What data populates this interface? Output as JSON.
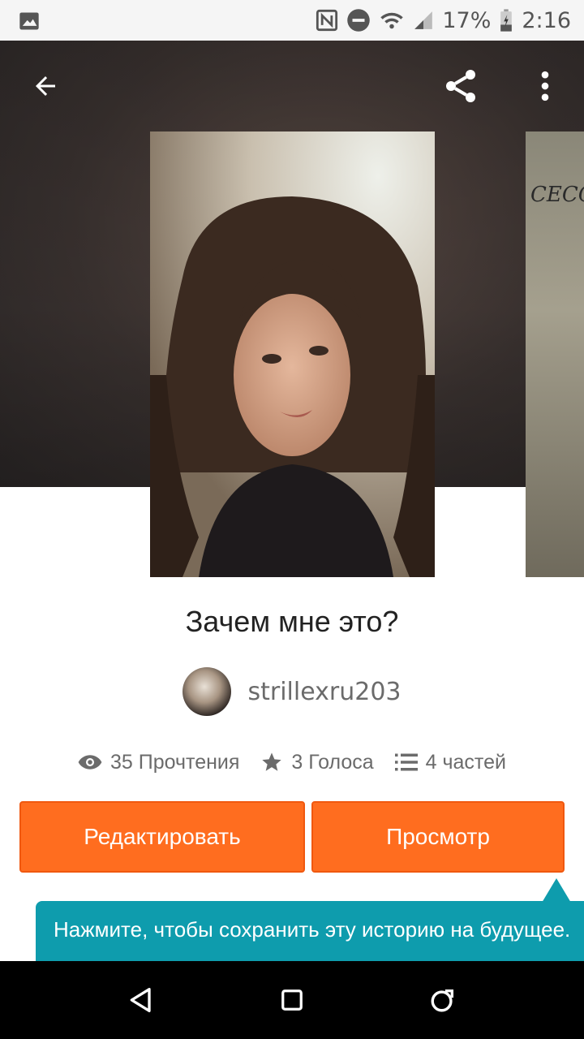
{
  "status_bar": {
    "battery": "17%",
    "time": "2:16",
    "icons": [
      "image-icon",
      "nfc-icon",
      "dnd-icon",
      "wifi-icon",
      "signal-icon",
      "battery-icon"
    ]
  },
  "header": {
    "icons": [
      "back-arrow-icon",
      "share-icon",
      "more-vert-icon"
    ]
  },
  "covers": {
    "next_cover_text": "СЕССИЯ"
  },
  "story": {
    "title": "Зачем мне это?",
    "author": "strillexru203",
    "stats": {
      "reads": "35 Прочтения",
      "votes": "3 Голоса",
      "parts": "4 частей"
    }
  },
  "actions": {
    "edit_label": "Редактировать",
    "view_label": "Просмотр"
  },
  "tooltip": {
    "text": "Нажмите, чтобы сохранить эту историю на будущее."
  },
  "navbar": {
    "icons": [
      "nav-back-icon",
      "nav-home-icon",
      "nav-recents-icon"
    ]
  },
  "colors": {
    "accent": "#ff6d1f",
    "tooltip": "#0e9cad"
  }
}
